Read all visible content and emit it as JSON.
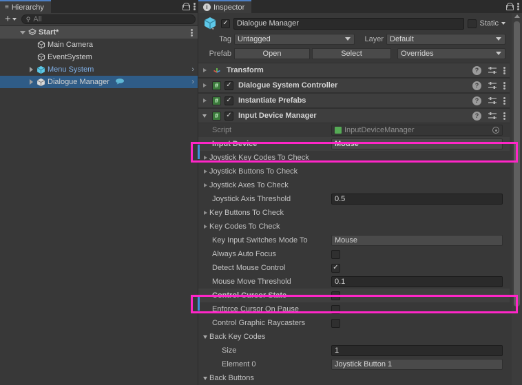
{
  "hierarchy": {
    "tab_label": "Hierarchy",
    "tab_icon": "hierarchy-icon",
    "lock_icon": "lock-icon",
    "menu_icon": "kebab-menu-icon",
    "toolbar": {
      "add_label": "+",
      "search_placeholder": "All",
      "search_icon": "search-icon"
    },
    "rows": [
      {
        "label": "Start*",
        "icon": "scene-icon",
        "indent": 0,
        "expanded": true,
        "type": "scene",
        "kebab": true
      },
      {
        "label": "Main Camera",
        "icon": "gameobject-icon",
        "indent": 2,
        "type": "object"
      },
      {
        "label": "EventSystem",
        "icon": "gameobject-icon",
        "indent": 2,
        "type": "object"
      },
      {
        "label": "Menu System",
        "icon": "prefab-icon",
        "indent": 1,
        "type": "prefab",
        "chevron": true
      },
      {
        "label": "Dialogue Manager",
        "icon": "prefab-icon",
        "indent": 1,
        "type": "prefab",
        "selected": true,
        "chevron": true,
        "badge": "dialogue-bubble-icon"
      }
    ]
  },
  "inspector": {
    "tab_label": "Inspector",
    "tab_icon": "info-icon",
    "lock_icon": "lock-icon",
    "menu_icon": "kebab-menu-icon",
    "gameobject": {
      "icon": "prefab-cube-icon",
      "enabled": true,
      "name": "Dialogue Manager",
      "static_label": "Static",
      "static_checked": false,
      "tag_label": "Tag",
      "tag_value": "Untagged",
      "layer_label": "Layer",
      "layer_value": "Default",
      "prefab_label": "Prefab",
      "prefab_open": "Open",
      "prefab_select": "Select",
      "prefab_overrides": "Overrides"
    },
    "components": [
      {
        "name": "Transform",
        "icon": "transform-icon",
        "expanded": false,
        "has_toggle": false
      },
      {
        "name": "Dialogue System Controller",
        "icon": "cs-script-icon",
        "expanded": false,
        "has_toggle": true,
        "enabled": true
      },
      {
        "name": "Instantiate Prefabs",
        "icon": "cs-script-icon",
        "expanded": false,
        "has_toggle": true,
        "enabled": true
      },
      {
        "name": "Input Device Manager",
        "icon": "cs-script-icon",
        "expanded": true,
        "has_toggle": true,
        "enabled": true
      }
    ],
    "properties": [
      {
        "label": "Script",
        "kind": "object",
        "value": "InputDeviceManager",
        "dim": true,
        "indent": 1
      },
      {
        "label": "Input Device",
        "kind": "dropdown",
        "value": "Mouse",
        "indent": 1,
        "highlight": true,
        "bold": true,
        "label_color": "blue"
      },
      {
        "label": "Joystick Key Codes To Check",
        "kind": "foldout",
        "indent": 0
      },
      {
        "label": "Joystick Buttons To Check",
        "kind": "foldout",
        "indent": 0
      },
      {
        "label": "Joystick Axes To Check",
        "kind": "foldout",
        "indent": 0
      },
      {
        "label": "Joystick Axis Threshold",
        "kind": "text",
        "value": "0.5",
        "indent": 1
      },
      {
        "label": "Key Buttons To Check",
        "kind": "foldout",
        "indent": 0
      },
      {
        "label": "Key Codes To Check",
        "kind": "foldout",
        "indent": 0
      },
      {
        "label": "Key Input Switches Mode To",
        "kind": "dropdown",
        "value": "Mouse",
        "indent": 1
      },
      {
        "label": "Always Auto Focus",
        "kind": "checkbox",
        "checked": false,
        "indent": 1
      },
      {
        "label": "Detect Mouse Control",
        "kind": "checkbox",
        "checked": true,
        "indent": 1
      },
      {
        "label": "Mouse Move Threshold",
        "kind": "text",
        "value": "0.1",
        "indent": 1
      },
      {
        "label": "Control Cursor State",
        "kind": "checkbox",
        "checked": false,
        "indent": 1,
        "highlight": true,
        "bold": true
      },
      {
        "label": "Enforce Cursor On Pause",
        "kind": "checkbox",
        "checked": false,
        "indent": 1
      },
      {
        "label": "Control Graphic Raycasters",
        "kind": "checkbox",
        "checked": false,
        "indent": 1
      },
      {
        "label": "Back Key Codes",
        "kind": "foldout-open",
        "indent": 0
      },
      {
        "label": "Size",
        "kind": "text",
        "value": "1",
        "indent": 2
      },
      {
        "label": "Element 0",
        "kind": "dropdown",
        "value": "Joystick Button 1",
        "indent": 2
      },
      {
        "label": "Back Buttons",
        "kind": "foldout-open",
        "indent": 0,
        "clipped": true
      }
    ],
    "scrollbar": {
      "up_arrow_icon": "scroll-up-arrow-icon"
    }
  },
  "colors": {
    "highlight": "#ff26c8",
    "selection": "#2f5c87",
    "accent_blue": "#3e8fd9",
    "panel_bg": "#383838",
    "header_bg": "#3e3e3e"
  }
}
